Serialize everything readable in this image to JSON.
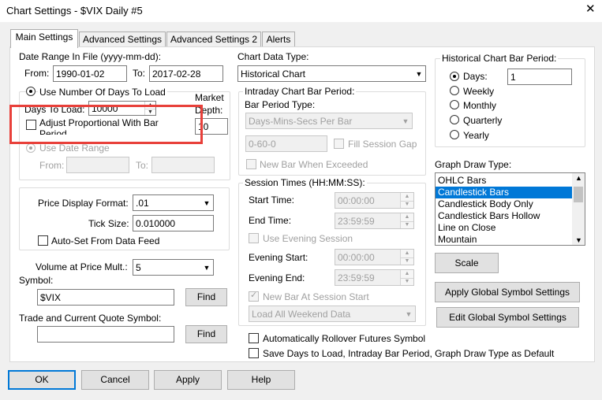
{
  "window": {
    "title": "Chart Settings - $VIX  Daily  #5",
    "close_glyph": "✕"
  },
  "tabs": [
    {
      "label": "Main Settings"
    },
    {
      "label": "Advanced Settings"
    },
    {
      "label": "Advanced Settings 2"
    },
    {
      "label": "Alerts"
    }
  ],
  "date_range": {
    "title": "Date Range In File (yyyy-mm-dd):",
    "from_label": "From:",
    "from_value": "1990-01-02",
    "to_label": "To:",
    "to_value": "2017-02-28"
  },
  "days_group": {
    "use_days_label": "Use Number Of Days To Load",
    "days_label": "Days To Load:",
    "days_value": "10000",
    "market_depth_label_1": "Market",
    "market_depth_label_2": "Depth:",
    "market_depth_value": "10",
    "adjust_label": "Adjust Proportional With Bar Period",
    "use_date_range_label": "Use Date Range",
    "dr_from_label": "From:",
    "dr_to_label": "To:"
  },
  "price": {
    "format_label": "Price Display Format:",
    "format_value": ".01",
    "tick_label": "Tick Size:",
    "tick_value": "0.010000",
    "auto_set_label": "Auto-Set From Data Feed"
  },
  "volume": {
    "label": "Volume at Price Mult.:",
    "value": "5"
  },
  "symbol": {
    "label": "Symbol:",
    "value": "$VIX",
    "find_label": "Find"
  },
  "trade_symbol": {
    "label": "Trade and Current Quote Symbol:",
    "value": "",
    "find_label": "Find"
  },
  "chart_data_type": {
    "label": "Chart Data Type:",
    "value": "Historical Chart"
  },
  "intraday": {
    "title": "Intraday Chart Bar Period:",
    "bar_period_type_label": "Bar Period Type:",
    "bar_period_type_value": "Days-Mins-Secs Per Bar",
    "period_value": "0-60-0",
    "fill_gap_label": "Fill Session Gap",
    "new_bar_label": "New Bar When Exceeded"
  },
  "session": {
    "title": "Session Times (HH:MM:SS):",
    "start_label": "Start Time:",
    "start_value": "00:00:00",
    "end_label": "End Time:",
    "end_value": "23:59:59",
    "use_evening_label": "Use Evening Session",
    "evening_start_label": "Evening Start:",
    "evening_start_value": "00:00:00",
    "evening_end_label": "Evening End:",
    "evening_end_value": "23:59:59",
    "new_bar_session_label": "New Bar At Session Start",
    "weekend_value": "Load All Weekend Data"
  },
  "options": {
    "rollover_label": "Automatically Rollover Futures Symbol",
    "save_default_label": "Save Days to Load, Intraday Bar Period, Graph Draw Type as Default"
  },
  "historical": {
    "title": "Historical Chart Bar Period:",
    "days_label": "Days:",
    "days_value": "1",
    "weekly_label": "Weekly",
    "monthly_label": "Monthly",
    "quarterly_label": "Quarterly",
    "yearly_label": "Yearly"
  },
  "graph_draw": {
    "label": "Graph Draw Type:",
    "items": [
      "OHLC Bars",
      "Candlestick Bars",
      "Candlestick Body Only",
      "Candlestick Bars Hollow",
      "Line on Close",
      "Mountain"
    ],
    "selected": "Candlestick Bars"
  },
  "buttons": {
    "scale": "Scale",
    "apply_global": "Apply Global Symbol Settings",
    "edit_global": "Edit Global Symbol Settings",
    "ok": "OK",
    "cancel": "Cancel",
    "apply": "Apply",
    "help": "Help"
  },
  "colors": {
    "highlight_box": "#e8403a",
    "selection": "#0078d7",
    "panel_bg": "#f0f0f0",
    "window_bg": "#ffffff"
  },
  "icons": {
    "dropdown": "chevron-down-icon",
    "spinner": "spin-arrows-icon",
    "close": "close-icon"
  }
}
